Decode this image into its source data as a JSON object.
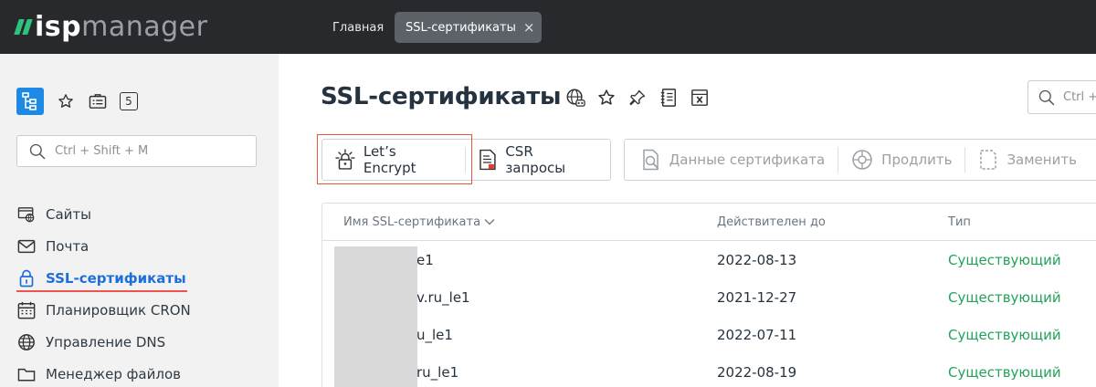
{
  "topbar": {
    "logo_isp": "isp",
    "logo_manager": "manager",
    "tabs": [
      {
        "label": "Главная"
      },
      {
        "label": "SSL-сертификаты",
        "close": "×"
      }
    ]
  },
  "sidebar": {
    "count_badge": "5",
    "search_placeholder": "Ctrl + Shift + M",
    "items": [
      {
        "label": "Сайты",
        "icon": "sites-icon"
      },
      {
        "label": "Почта",
        "icon": "mail-icon"
      },
      {
        "label": "SSL-сертификаты",
        "icon": "lock-icon",
        "active": true
      },
      {
        "label": "Планировщик CRON",
        "icon": "calendar-icon"
      },
      {
        "label": "Управление DNS",
        "icon": "globe-icon"
      },
      {
        "label": "Менеджер файлов",
        "icon": "folder-icon"
      }
    ]
  },
  "main": {
    "title": "SSL-сертификаты",
    "search_placeholder": "Ctrl +",
    "toolbar": {
      "lets_encrypt": "Let’s Encrypt",
      "csr": "CSR запросы",
      "cert_data": "Данные сертификата",
      "renew": "Продлить",
      "replace": "Заменить"
    },
    "table": {
      "headers": {
        "name": "Имя SSL-сертификата",
        "valid_until": "Действителен до",
        "type": "Тип"
      },
      "rows": [
        {
          "name": "e1",
          "valid_until": "2022-08-13",
          "type": "Существующий"
        },
        {
          "name": "v.ru_le1",
          "valid_until": "2021-12-27",
          "type": "Существующий"
        },
        {
          "name": "u_le1",
          "valid_until": "2022-07-11",
          "type": "Существующий"
        },
        {
          "name": "ru_le1",
          "valid_until": "2022-08-19",
          "type": "Существующий"
        }
      ]
    }
  },
  "colors": {
    "topbar": "#27292c",
    "accent": "#1e88e5",
    "active_link": "#1e6fd9",
    "status_green": "#22a35a",
    "highlight_red": "#e8553b"
  }
}
